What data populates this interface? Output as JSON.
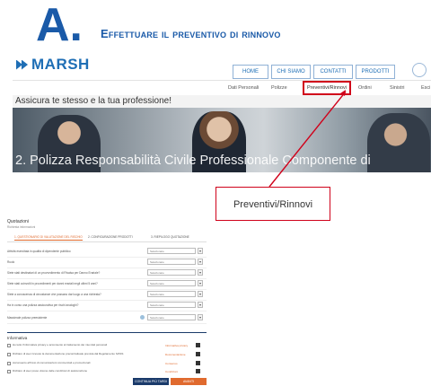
{
  "heading": {
    "letter": "A.",
    "text": "Effettuare il preventivo di rinnovo"
  },
  "site": {
    "logo": "MARSH",
    "top_nav": [
      "HOME",
      "CHI SIAMO",
      "CONTATTI",
      "PRODOTTI"
    ],
    "sub_nav": [
      "Dati Personali",
      "Polizze",
      "Preventivi/Rinnovi",
      "Ordini",
      "Sinistri",
      "Esci"
    ],
    "tagline": "Assicura te stesso e la tua professione!",
    "hero_title": "2. Polizza Responsabilità Civile Professionale Componente di"
  },
  "callout": {
    "label": "Preventivi/Rinnovi"
  },
  "form": {
    "title": "Quotazioni",
    "subtitle": "Richiesta informazioni",
    "tabs": [
      "1. QUESTIONARIO DI VALUTAZIONE DEL RISCHIO",
      "2. CONFIGURAZIONE PRODOTTI",
      "3. RIEPILOGO QUOTAZIONE"
    ],
    "questions": [
      {
        "label": "Attività esercitata in qualità di dipendente pubblico",
        "value": "Selezionare"
      },
      {
        "label": "Ruolo",
        "value": "Selezionare"
      },
      {
        "label": "Siete stati destinatari di un provvedimento di Rivalsa per Danno Erariale?",
        "value": "Selezionare"
      },
      {
        "label": "Siete stati coinvolti in procedimenti per danni erariali negli ultimi 5 anni?",
        "value": "Selezionare"
      },
      {
        "label": "Siete a conoscenza di circostanze che possano dar luogo a una richiesta?",
        "value": "Selezionare"
      },
      {
        "label": "Ha in corso una polizza assicurativa per rischi analoghi?",
        "value": "Selezionare"
      },
      {
        "label": "Massimale polizza preesistente",
        "value": "Selezionare"
      }
    ],
    "info_title": "Informativa",
    "consents": [
      {
        "label": "Ho letto l'informativa privacy e acconsento al trattamento dei miei dati personali",
        "link": "Informativa privacy"
      },
      {
        "label": "Dichiaro di aver ricevuto la documentazione precontrattuale prevista dal Regolamento IVASS",
        "link": "Documentazione"
      },
      {
        "label": "Acconsento all'invio di comunicazioni commerciali e promozionali",
        "link": "Consenso"
      },
      {
        "label": "Dichiaro di aver preso visione delle condizioni di assicurazione",
        "link": "Condizioni"
      }
    ],
    "buttons": {
      "back": "CONTINUA PIÙ TARDI",
      "next": "AVANTI"
    }
  },
  "colors": {
    "heading_blue": "#1a5aa8",
    "marsh_blue": "#1e6eb5",
    "highlight_red": "#d0021b",
    "accent_orange": "#e06a2e",
    "navy": "#1a3a6a"
  }
}
